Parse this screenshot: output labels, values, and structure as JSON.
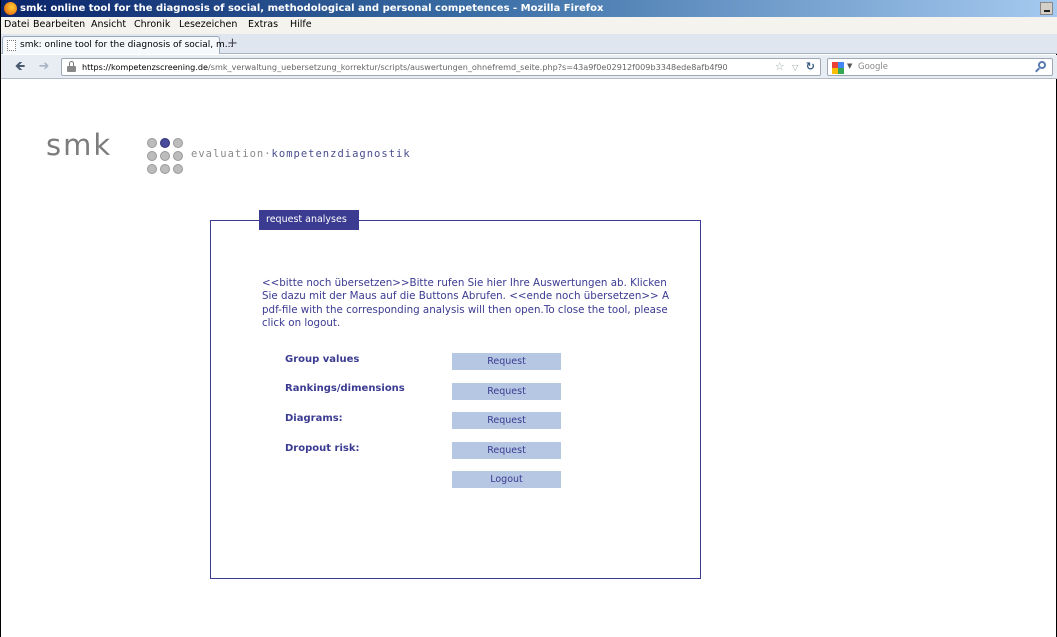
{
  "window": {
    "title": "smk: online tool for the diagnosis of social, methodological and personal competences - Mozilla Firefox"
  },
  "menubar": {
    "items": [
      "Datei",
      "Bearbeiten",
      "Ansicht",
      "Chronik",
      "Lesezeichen",
      "Extras",
      "Hilfe"
    ]
  },
  "tabs": [
    {
      "label": "smk: online tool for the diagnosis of social, m..."
    }
  ],
  "new_tab_label": "+",
  "navigation": {
    "url_domain": "https://kompetenzscreening.de",
    "url_path": "/smk_verwaltung_uebersetzung_korrektur/scripts/auswertungen_ohnefremd_seite.php?s=43a9f0e02912f009b3348ede8afb4f90",
    "search_engine": "Google"
  },
  "page": {
    "logo_text": "smk",
    "tagline_prefix": "evaluation·",
    "tagline_highlight": "kompetenzdiagnostik",
    "panel_title": "request analyses",
    "intro_text": "<<bitte noch übersetzen>>Bitte rufen Sie hier Ihre Auswertungen ab. Klicken Sie dazu mit der Maus auf die Buttons Abrufen. <<ende noch übersetzen>> A pdf-file with the corresponding analysis will then open.To close the tool, please click on logout.",
    "rows": [
      {
        "label": "Group values",
        "button": "Request"
      },
      {
        "label": "Rankings/dimensions",
        "button": "Request"
      },
      {
        "label": "Diagrams:",
        "button": "Request"
      },
      {
        "label": "Dropout risk:",
        "button": "Request"
      }
    ],
    "logout_label": "Logout"
  },
  "colors": {
    "brand_blue": "#3b3b92",
    "button_bg": "#b5c7e2",
    "logo_grey": "#7c7c7c"
  }
}
